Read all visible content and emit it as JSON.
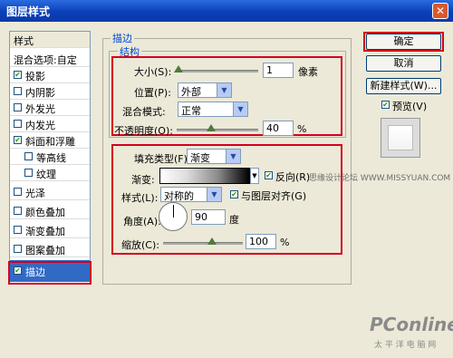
{
  "window": {
    "title": "图层样式"
  },
  "left_panel": {
    "header": "样式",
    "blend_options": "混合选项:自定",
    "items": [
      {
        "label": "投影",
        "checked": true
      },
      {
        "label": "内阴影",
        "checked": false
      },
      {
        "label": "外发光",
        "checked": false
      },
      {
        "label": "内发光",
        "checked": false
      },
      {
        "label": "斜面和浮雕",
        "checked": true
      },
      {
        "label": "等高线",
        "checked": false
      },
      {
        "label": "纹理",
        "checked": false
      },
      {
        "label": "光泽",
        "checked": false
      },
      {
        "label": "颜色叠加",
        "checked": false
      },
      {
        "label": "渐变叠加",
        "checked": false
      },
      {
        "label": "图案叠加",
        "checked": false
      },
      {
        "label": "描边",
        "checked": true
      }
    ]
  },
  "stroke": {
    "group_title": "描边",
    "structure_title": "结构",
    "size_label": "大小(S):",
    "size_value": "1",
    "size_unit": "像素",
    "position_label": "位置(P):",
    "position_value": "外部",
    "blend_label": "混合模式:",
    "blend_value": "正常",
    "opacity_label": "不透明度(O):",
    "opacity_value": "40",
    "opacity_unit": "%",
    "fill_type_label": "填充类型(F):",
    "fill_type_value": "渐变",
    "gradient_label": "渐变:",
    "reverse_label": "反向(R)",
    "style_label": "样式(L):",
    "style_value": "对称的",
    "align_label": "与图层对齐(G)",
    "angle_label": "角度(A):",
    "angle_value": "90",
    "angle_unit": "度",
    "scale_label": "缩放(C):",
    "scale_value": "100",
    "scale_unit": "%"
  },
  "buttons": {
    "ok": "确定",
    "cancel": "取消",
    "new_style": "新建样式(W)...",
    "preview": "预览(V)"
  },
  "watermark": {
    "site": "思缘设计论坛  WWW.MISSYUAN.COM",
    "brand": "PConline",
    "brand_sub": "太 平 洋 电 脑 网"
  }
}
